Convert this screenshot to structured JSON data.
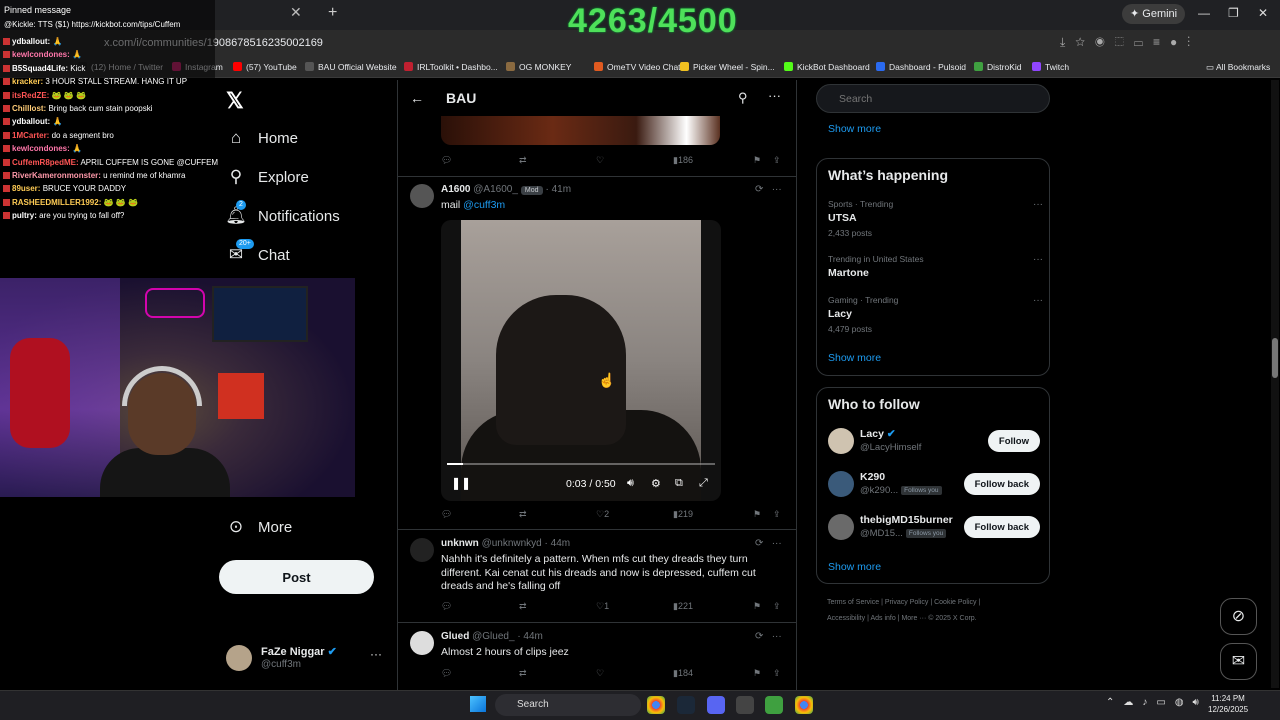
{
  "counter": "4263/4500",
  "browser": {
    "url": "x.com/i/communities/1908678516235002169",
    "gemini_label": "Gemini",
    "bookmarks": [
      {
        "label": "(12) Home / Twitter",
        "color": "#222"
      },
      {
        "label": "Instagram",
        "color": "#d62976"
      },
      {
        "label": "(57) YouTube",
        "color": "#f00"
      },
      {
        "label": "BAU Official Website",
        "color": "#555"
      },
      {
        "label": "IRLToolkit • Dashbo...",
        "color": "#c02030"
      },
      {
        "label": "OG MONKEY",
        "color": "#8a6a40"
      },
      {
        "label": "OmeTV Video Chat...",
        "color": "#e05a20"
      },
      {
        "label": "Picker Wheel - Spin...",
        "color": "#f0c020"
      },
      {
        "label": "KickBot Dashboard",
        "color": "#53fc18"
      },
      {
        "label": "Dashboard - Pulsoid",
        "color": "#2a6af0"
      },
      {
        "label": "DistroKid",
        "color": "#3fa040"
      },
      {
        "label": "Twitch",
        "color": "#9146ff"
      }
    ],
    "all_bookmarks": "All Bookmarks"
  },
  "chat": {
    "pinned_title": "Pinned message",
    "pinned_text": "@Kickle: TTS ($1) https://kickbot.com/tips/Cuffem",
    "messages": [
      {
        "user": "ydballout:",
        "text": "🙏",
        "color": "#fff"
      },
      {
        "user": "kewlcondones:",
        "text": "🙏",
        "color": "#f7a"
      },
      {
        "user": "B5Squad4Life:",
        "text": "Kick",
        "color": "#fff"
      },
      {
        "user": "kracker:",
        "text": "3 HOUR STALL STREAM. HANG IT UP",
        "color": "#fc5"
      },
      {
        "user": "itsRedZE:",
        "text": "🐸 🐸 🐸",
        "color": "#f55"
      },
      {
        "user": "Chilllost:",
        "text": "Bring back cum stain poopski",
        "color": "#fc7"
      },
      {
        "user": "ydballout:",
        "text": "🙏",
        "color": "#fff"
      },
      {
        "user": "1MCarter:",
        "text": "do a segment bro",
        "color": "#f55"
      },
      {
        "user": "kewlcondones:",
        "text": "🙏",
        "color": "#f7a"
      },
      {
        "user": "CuffemR8pedME:",
        "text": "APRIL CUFFEM IS GONE @CUFFEM",
        "color": "#f55"
      },
      {
        "user": "RiverKameronmonster:",
        "text": "u remind me of khamra",
        "color": "#f9a"
      },
      {
        "user": "89user:",
        "text": "BRUCE YOUR DADDY",
        "color": "#fc5"
      },
      {
        "user": "RASHEEDMILLER1992:",
        "text": "🐸 🐸 🐸",
        "color": "#fc5"
      },
      {
        "user": "pultry:",
        "text": "are you trying to fall off?",
        "color": "#fff"
      }
    ]
  },
  "nav": {
    "home": "Home",
    "explore": "Explore",
    "notifications": "Notifications",
    "notifications_badge": "2",
    "chat": "Chat",
    "chat_badge": "20+",
    "more": "More",
    "post": "Post",
    "account_name": "FaZe Niggar",
    "account_handle": "@cuff3m"
  },
  "community": {
    "title": "BAU",
    "top_post_views": "186",
    "posts": [
      {
        "name": "A1600",
        "handle": "@A1600_",
        "badge": "Mod",
        "time": "· 41m",
        "text_prefix": "mail ",
        "mention": "@cuff3m",
        "likes": "2",
        "views": "219",
        "video_time": "0:03 / 0:50",
        "video_progress": 0.06
      },
      {
        "name": "unknwn",
        "handle": "@unknwnkyd",
        "time": "· 44m",
        "text": "Nahhh it's definitely a pattern. When mfs cut they dreads they turn different. Kai cenat cut his dreads and now is depressed, cuffem cut dreads and he's falling off",
        "likes": "1",
        "views": "221"
      },
      {
        "name": "Glued",
        "handle": "@Glued_",
        "time": "· 44m",
        "text": "Almost 2 hours of clips jeez",
        "views": "184"
      }
    ]
  },
  "right": {
    "search_placeholder": "Search",
    "show_more": "Show more",
    "whats_happening": "What’s happening",
    "trends": [
      {
        "category": "Sports · Trending",
        "name": "UTSA",
        "count": "2,433 posts"
      },
      {
        "category": "Trending in United States",
        "name": "Martone",
        "count": ""
      },
      {
        "category": "Gaming · Trending",
        "name": "Lacy",
        "count": "4,479 posts"
      }
    ],
    "who_to_follow": "Who to follow",
    "follows": [
      {
        "name": "Lacy",
        "handle": "@LacyHimself",
        "follows_you": "",
        "button": "Follow",
        "avatar": "#cfc3b0"
      },
      {
        "name": "K290",
        "handle": "@k290...",
        "follows_you": "Follows you",
        "button": "Follow back",
        "avatar": "#3a5a7a"
      },
      {
        "name": "thebigMD15burner",
        "handle": "@MD15...",
        "follows_you": "Follows you",
        "button": "Follow back",
        "avatar": "#6a6a6a"
      }
    ],
    "footer_line1": "Terms of Service  |  Privacy Policy  |  Cookie Policy  |",
    "footer_line2": "Accessibility  |  Ads info  |  More ···  © 2025 X Corp."
  },
  "taskbar": {
    "search": "Search",
    "time": "11:24 PM",
    "date": "12/26/2025"
  }
}
